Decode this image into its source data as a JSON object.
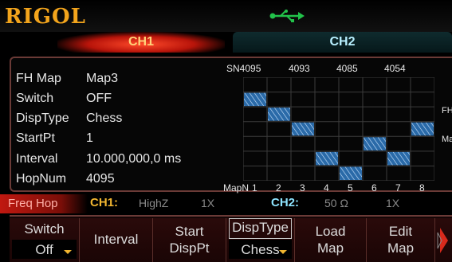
{
  "brand": "RIGOL",
  "icons": {
    "usb": "usb-icon"
  },
  "tabs": {
    "ch1": "CH1",
    "ch2": "CH2"
  },
  "params": [
    {
      "label": "FH Map",
      "value": "Map3"
    },
    {
      "label": "Switch",
      "value": "OFF"
    },
    {
      "label": "DispType",
      "value": "Chess"
    },
    {
      "label": "StartPt",
      "value": "1"
    },
    {
      "label": "Interval",
      "value": "10.000,000,0 ms"
    },
    {
      "label": "HopNum",
      "value": "4095"
    }
  ],
  "map": {
    "sn_prefix": "SN",
    "sn_values": [
      "4095",
      "4093",
      "4085",
      "4054"
    ],
    "mapn_label": "MapN",
    "mapn_values": [
      "1",
      "2",
      "3",
      "4",
      "5",
      "6",
      "7",
      "8"
    ],
    "side_labels": [
      "FH",
      "Map"
    ],
    "hatch_color": "#2a6aa8"
  },
  "status": {
    "mode": "Freq Hop",
    "ch1_label": "CH1:",
    "ch1_imp": "HighZ",
    "ch1_scale": "1X",
    "ch2_label": "CH2:",
    "ch2_imp": "50 Ω",
    "ch2_scale": "1X"
  },
  "softkeys": {
    "switch_label": "Switch",
    "switch_value": "Off",
    "interval_label": "Interval",
    "startpt_line1": "Start",
    "startpt_line2": "DispPt",
    "disptype_label": "DispType",
    "disptype_value": "Chess",
    "loadmap_line1": "Load",
    "loadmap_line2": "Map",
    "editmap_line1": "Edit",
    "editmap_line2": "Map"
  },
  "colors": {
    "accent": "#f2a41c",
    "ch1": "#ffd37a",
    "ch2": "#b8f0ff",
    "frame": "#6a3a36"
  }
}
